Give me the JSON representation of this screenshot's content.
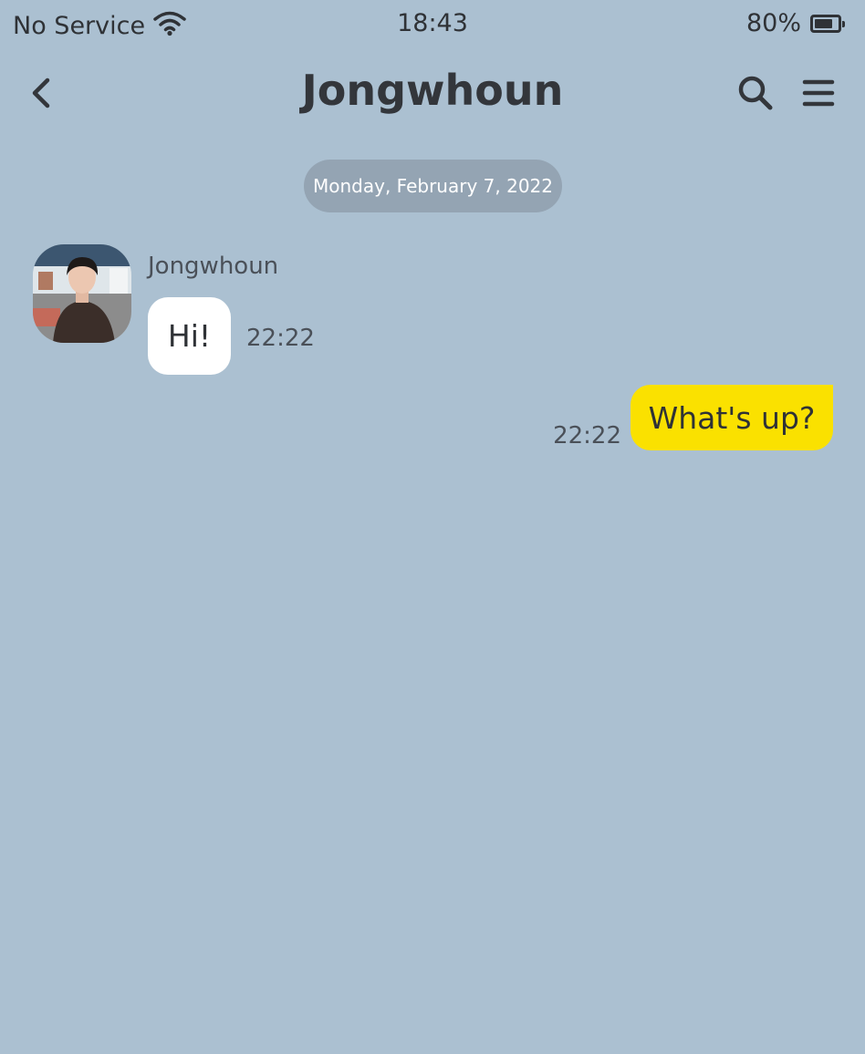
{
  "status_bar": {
    "carrier": "No Service",
    "time": "18:43",
    "battery": "80%",
    "battery_level": 0.8
  },
  "header": {
    "title": "Jongwhoun",
    "back_icon": "chevron-left-icon",
    "search_icon": "search-icon",
    "menu_icon": "hamburger-menu-icon"
  },
  "chat": {
    "date_divider": "Monday, February 7, 2022",
    "messages": [
      {
        "direction": "incoming",
        "sender": "Jongwhoun",
        "text": "Hi!",
        "time": "22:22"
      },
      {
        "direction": "outgoing",
        "text": "What's up?",
        "time": "22:22"
      }
    ]
  },
  "colors": {
    "background": "#abc0d1",
    "incoming_bubble": "#ffffff",
    "outgoing_bubble": "#fae100",
    "date_pill": "#94a4b3"
  }
}
